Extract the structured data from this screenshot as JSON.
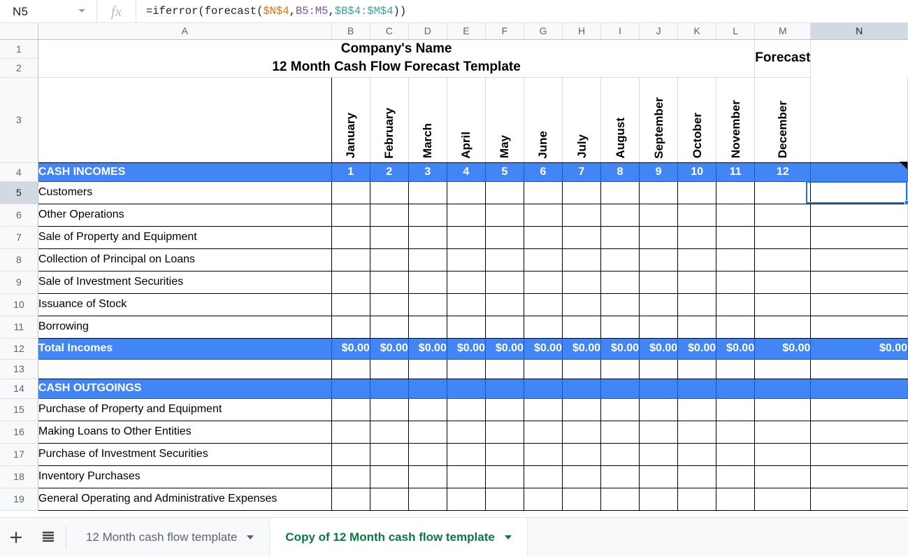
{
  "formula_bar": {
    "name_box_value": "N5",
    "fx_label": "fx",
    "formula_parts": [
      {
        "text": "=iferror(forecast(",
        "cls": "tok-plain"
      },
      {
        "text": "$N$4",
        "cls": "tok-ref-a"
      },
      {
        "text": ",",
        "cls": "tok-plain"
      },
      {
        "text": "B5:M5",
        "cls": "tok-ref-b"
      },
      {
        "text": ",",
        "cls": "tok-plain"
      },
      {
        "text": "$B$4:$M$4",
        "cls": "tok-ref-c"
      },
      {
        "text": "))",
        "cls": "tok-plain"
      }
    ],
    "formula_text": "=iferror(forecast($N$4,B5:M5,$B$4:$M$4))"
  },
  "grid": {
    "column_headers": [
      "A",
      "B",
      "C",
      "D",
      "E",
      "F",
      "G",
      "H",
      "I",
      "J",
      "K",
      "L",
      "M",
      "N"
    ],
    "selected_column": "N",
    "selected_row": "5",
    "selected_cell": "N5",
    "row_numbers": [
      "1",
      "2",
      "3",
      "4",
      "5",
      "6",
      "7",
      "8",
      "9",
      "10",
      "11",
      "12",
      "13",
      "14",
      "15",
      "16",
      "17",
      "18",
      "19"
    ],
    "title_line1": "Company's Name",
    "title_line2": "12 Month Cash Flow Forecast Template",
    "forecast_header": "Forecast",
    "months": [
      "January",
      "February",
      "March",
      "April",
      "May",
      "June",
      "July",
      "August",
      "September",
      "October",
      "November",
      "December"
    ],
    "month_numbers": [
      "1",
      "2",
      "3",
      "4",
      "5",
      "6",
      "7",
      "8",
      "9",
      "10",
      "11",
      "12"
    ],
    "cash_incomes_header": "CASH INCOMES",
    "income_rows": [
      "Customers",
      "Other Operations",
      "Sale of Property and Equipment",
      "Collection of Principal on Loans",
      "Sale of Investment Securities",
      "Issuance of Stock",
      "Borrowing"
    ],
    "total_incomes_label": "Total Incomes",
    "total_incomes_values": [
      "$0.00",
      "$0.00",
      "$0.00",
      "$0.00",
      "$0.00",
      "$0.00",
      "$0.00",
      "$0.00",
      "$0.00",
      "$0.00",
      "$0.00",
      "$0.00"
    ],
    "total_incomes_forecast": "$0.00",
    "cash_outgoings_header": "CASH OUTGOINGS",
    "outgoing_rows": [
      "Purchase of Property and Equipment",
      "Making Loans to Other Entities",
      "Purchase of Investment Securities",
      "Inventory Purchases",
      "General Operating and Administrative Expenses"
    ]
  },
  "tabbar": {
    "add_sheet_label": "+",
    "all_sheets_label": "☰",
    "tabs": [
      {
        "label": "12 Month cash flow template",
        "active": false
      },
      {
        "label": "Copy of 12 Month cash flow template",
        "active": true
      }
    ]
  },
  "colors": {
    "accent_blue": "#4285F4",
    "selection_blue": "#1a73e8",
    "active_tab_green": "#0b7a3e",
    "header_gray": "#f8f9fa"
  }
}
